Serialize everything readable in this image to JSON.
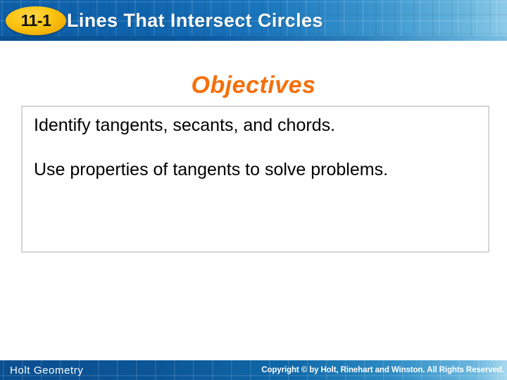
{
  "header": {
    "lesson_number": "11-1",
    "title": "Lines That Intersect Circles",
    "banner_color": "#0d5fa8",
    "badge_color": "#fcc613",
    "badge_text_color": "#111111",
    "title_color": "#ffffff"
  },
  "main": {
    "section_title": "Objectives",
    "section_title_color": "#F4700A",
    "objectives": [
      "Identify tangents, secants, and chords.",
      "Use properties of tangents to solve problems."
    ],
    "box_border_color": "#d6d6d6"
  },
  "footer": {
    "book_title": "Holt Geometry",
    "copyright": "Copyright © by Holt, Rinehart and Winston. All Rights Reserved.",
    "banner_color": "#0a4f90",
    "text_color": "#ffffff"
  }
}
